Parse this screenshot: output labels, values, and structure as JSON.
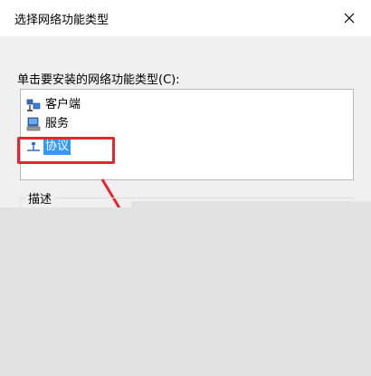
{
  "dialog": {
    "title": "选择网络功能类型",
    "close_icon": "close-icon"
  },
  "prompt": "单击要安装的网络功能类型(C):",
  "list": {
    "items": [
      {
        "label": "客户端",
        "icon": "client-icon",
        "selected": false
      },
      {
        "label": "服务",
        "icon": "service-icon",
        "selected": false
      },
      {
        "label": "协议",
        "icon": "protocol-icon",
        "selected": true
      }
    ]
  },
  "description": {
    "label": "描述"
  },
  "colors": {
    "highlight": "#e3262f",
    "selection": "#3399ff"
  }
}
